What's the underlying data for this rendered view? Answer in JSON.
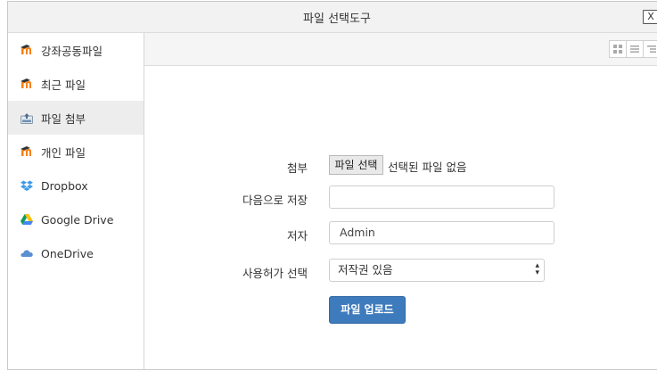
{
  "dialog": {
    "title": "파일 선택도구",
    "close_label": "X"
  },
  "sidebar": {
    "items": [
      {
        "label": "강좌공동파일",
        "icon": "moodle-icon"
      },
      {
        "label": "최근 파일",
        "icon": "moodle-icon"
      },
      {
        "label": "파일 첨부",
        "icon": "upload-icon",
        "active": true
      },
      {
        "label": "개인 파일",
        "icon": "moodle-icon"
      },
      {
        "label": "Dropbox",
        "icon": "dropbox-icon"
      },
      {
        "label": "Google Drive",
        "icon": "google-drive-icon"
      },
      {
        "label": "OneDrive",
        "icon": "onedrive-icon"
      }
    ]
  },
  "toolbar": {
    "views": [
      "icons-view-icon",
      "list-view-icon",
      "tree-view-icon"
    ]
  },
  "form": {
    "attach_label": "첨부",
    "file_button": "파일 선택",
    "file_status": "선택된 파일 없음",
    "saveas_label": "다음으로 저장",
    "saveas_value": "",
    "author_label": "저자",
    "author_value": "Admin",
    "license_label": "사용허가 선택",
    "license_value": "저작권 있음",
    "upload_button": "파일 업로드"
  },
  "colors": {
    "accent": "#3e7bbd",
    "moodle_orange": "#f98012",
    "dropbox_blue": "#3d9ae8",
    "active_bg": "#ededed"
  }
}
